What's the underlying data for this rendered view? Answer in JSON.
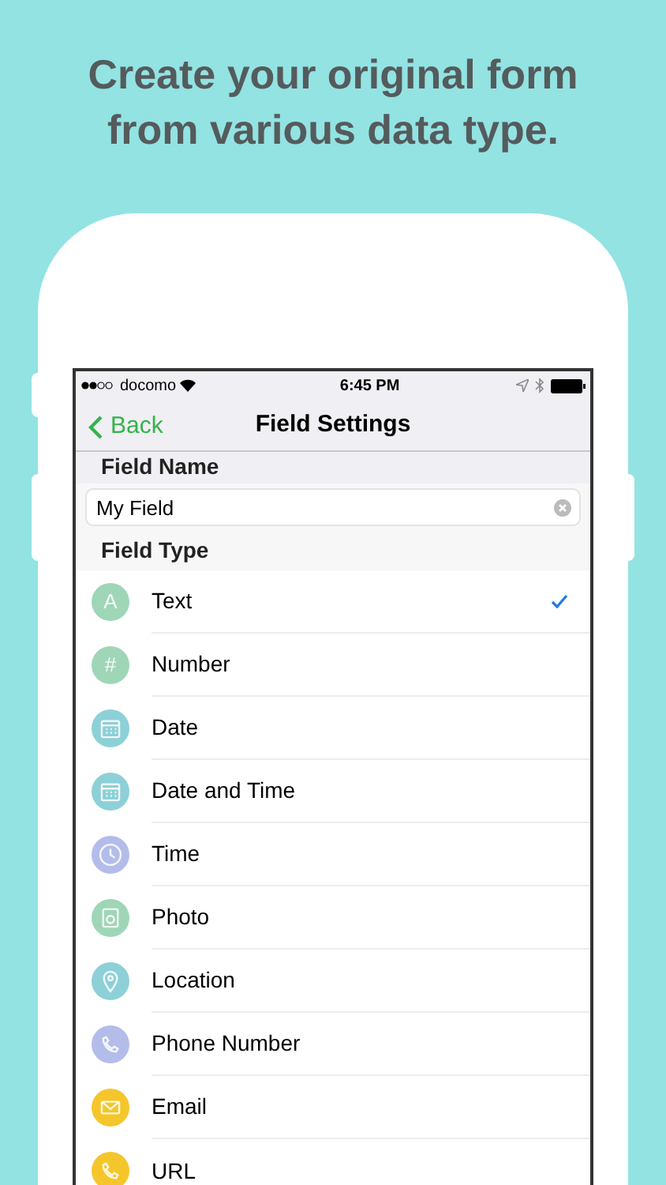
{
  "headline": "Create your original form from various data type.",
  "status_bar": {
    "carrier": "docomo",
    "time": "6:45 PM"
  },
  "nav": {
    "back": "Back",
    "title": "Field Settings"
  },
  "field_name": {
    "header": "Field Name",
    "value": "My Field"
  },
  "field_type": {
    "header": "Field Type",
    "items": [
      {
        "kind": "glyph",
        "glyph": "A",
        "label": "Text",
        "color": "#9fd6b7",
        "selected": true
      },
      {
        "kind": "glyph",
        "glyph": "#",
        "label": "Number",
        "color": "#9fd6b7",
        "selected": false
      },
      {
        "kind": "calendar",
        "label": "Date",
        "color": "#8dd0d7",
        "selected": false
      },
      {
        "kind": "calendar",
        "label": "Date and Time",
        "color": "#8dd0d7",
        "selected": false
      },
      {
        "kind": "clock",
        "label": "Time",
        "color": "#b4bde9",
        "selected": false
      },
      {
        "kind": "photo",
        "label": "Photo",
        "color": "#9fd6b7",
        "selected": false
      },
      {
        "kind": "pin",
        "label": "Location",
        "color": "#8dd0d7",
        "selected": false
      },
      {
        "kind": "phone",
        "label": "Phone Number",
        "color": "#b4bde9",
        "selected": false
      },
      {
        "kind": "mail",
        "label": "Email",
        "color": "#f5c62b",
        "selected": false
      },
      {
        "kind": "phone",
        "label": "URL",
        "color": "#f5c62b",
        "selected": false
      }
    ]
  }
}
